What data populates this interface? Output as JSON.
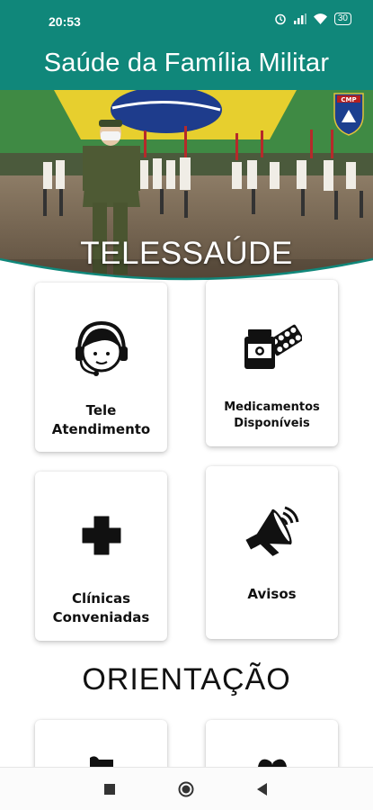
{
  "status_bar": {
    "time": "20:53",
    "battery": "30"
  },
  "app_bar": {
    "title": "Saúde da Família Militar"
  },
  "banner": {
    "title": "TELESSAÚDE",
    "badge_text": "CMP"
  },
  "cards": {
    "tele": {
      "line1": "Tele",
      "line2": "Atendimento",
      "icon": "headset-agent-icon"
    },
    "medicamentos": {
      "line1": "Medicamentos",
      "line2": "Disponíveis",
      "icon": "medicine-bottle-pills-icon"
    },
    "clinicas": {
      "line1": "Clínicas",
      "line2": "Conveniadas",
      "icon": "medical-cross-icon"
    },
    "avisos": {
      "label": "Avisos",
      "icon": "megaphone-icon"
    }
  },
  "section": {
    "title": "ORIENTAÇÃO"
  },
  "colors": {
    "primary": "#10877a",
    "card_text": "#111111"
  }
}
